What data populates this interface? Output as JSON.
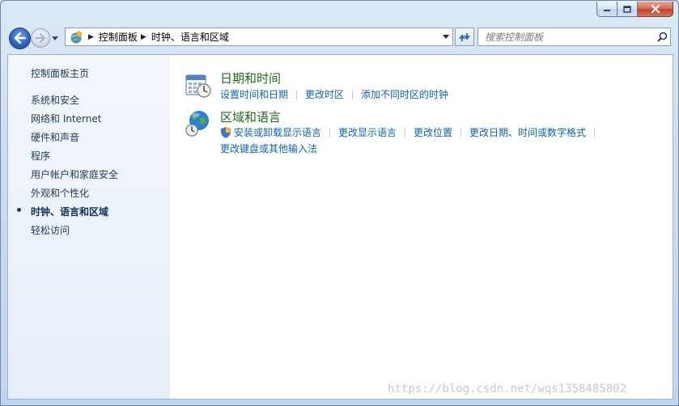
{
  "window": {
    "caption_buttons": [
      "minimize-icon",
      "maximize-icon",
      "close-icon"
    ]
  },
  "nav": {
    "breadcrumb": [
      "控制面板",
      "时钟、语言和区域"
    ],
    "search_placeholder": "搜索控制面板"
  },
  "sidebar": {
    "home": "控制面板主页",
    "items": [
      "系统和安全",
      "网络和 Internet",
      "硬件和声音",
      "程序",
      "用户帐户和家庭安全",
      "外观和个性化",
      "时钟、语言和区域",
      "轻松访问"
    ],
    "active_index": 6
  },
  "categories": [
    {
      "title": "日期和时间",
      "icon": "calendar-clock-icon",
      "links": [
        "设置时间和日期",
        "更改时区",
        "添加不同时区的时钟"
      ]
    },
    {
      "title": "区域和语言",
      "icon": "globe-clock-icon",
      "links_row1": [
        "安装或卸载显示语言",
        "更改显示语言",
        "更改位置",
        "更改日期、时间或数字格式"
      ],
      "links_row2": [
        "更改键盘或其他输入法"
      ],
      "shield_on_first": true
    }
  ],
  "watermark": "https://blog.csdn.net/wqs1358485802",
  "colors": {
    "link": "#0b63b7",
    "category_title": "#1f6b1f",
    "sidebar_text": "#1e395b"
  }
}
